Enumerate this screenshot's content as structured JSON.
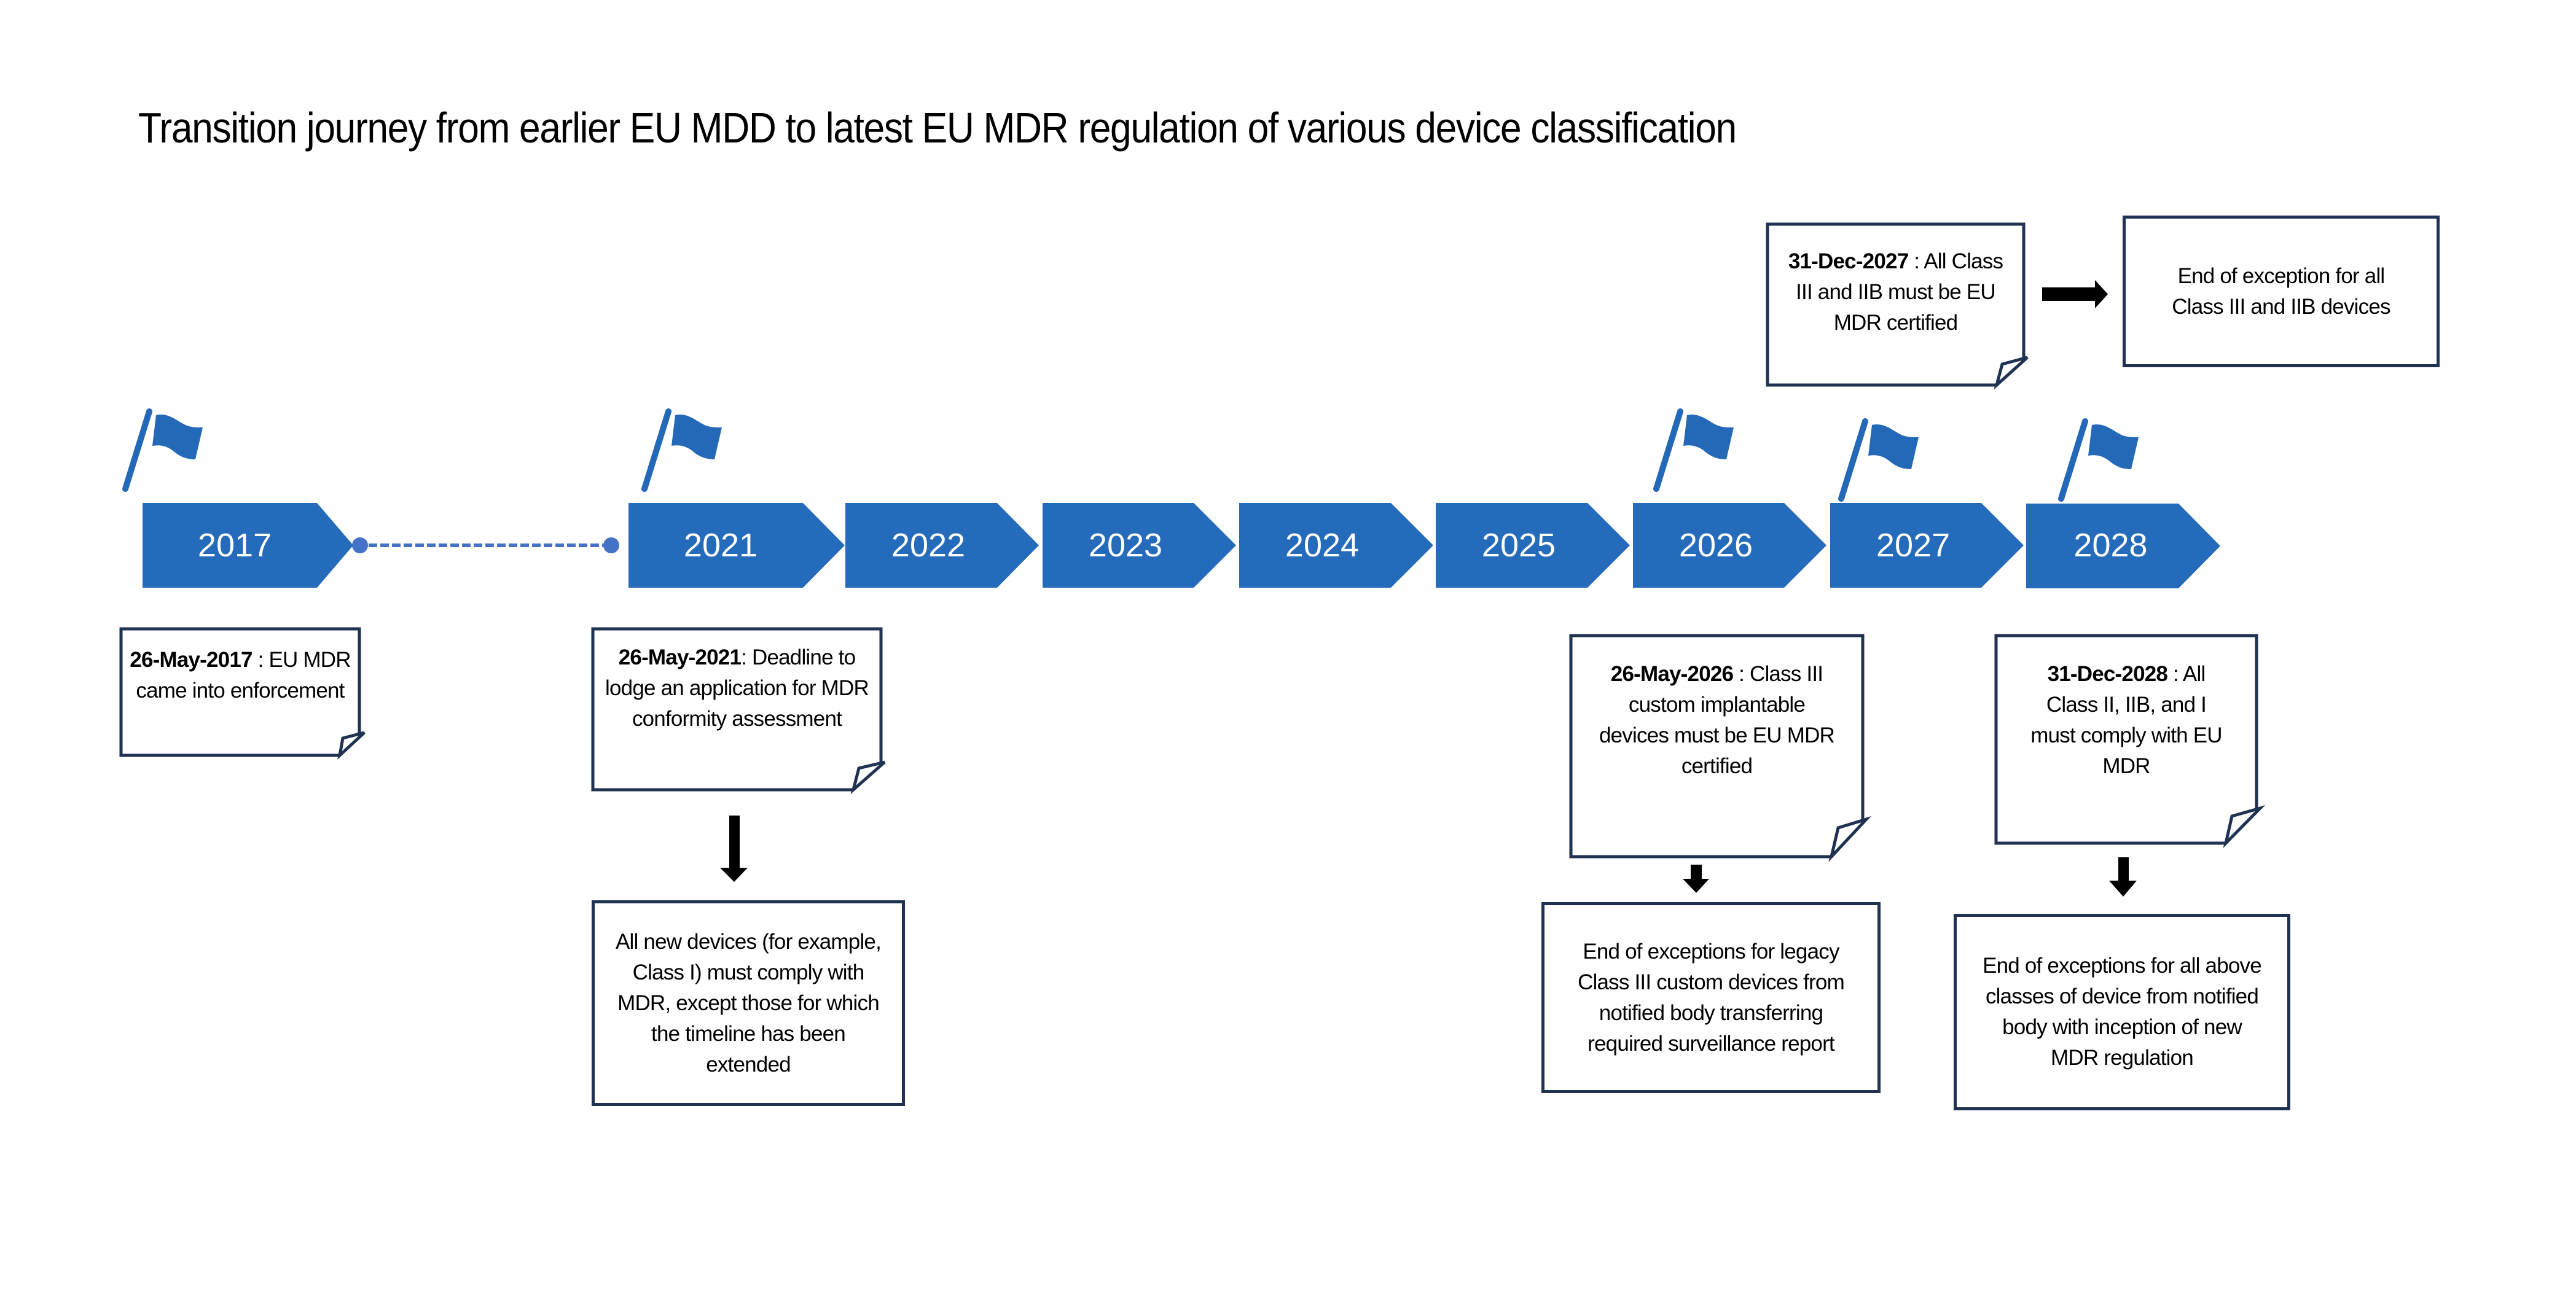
{
  "title": "Transition journey from earlier EU MDD to latest EU MDR regulation of various device classification",
  "colors": {
    "chevron": "#256bbb",
    "flag": "#2468b8",
    "connector": "#4472c4",
    "box_border": "#1f3251",
    "arrow": "#000000"
  },
  "timeline": {
    "years": [
      "2017",
      "2021",
      "2022",
      "2023",
      "2024",
      "2025",
      "2026",
      "2027",
      "2028"
    ],
    "flagged_years": [
      "2017",
      "2021",
      "2026",
      "2027",
      "2028"
    ]
  },
  "milestones": {
    "m2017": {
      "date": "26-May-2017",
      "sep": " : ",
      "text": "EU MDR came into enforcement"
    },
    "m2021": {
      "date": "26-May-2021",
      "sep": ": ",
      "text": "Deadline to lodge an application for MDR conformity assessment"
    },
    "m2026": {
      "date": "26-May-2026",
      "sep": " : ",
      "text": "Class III custom implantable devices must be EU MDR certified"
    },
    "m2027": {
      "date": "31-Dec-2027",
      "sep": " : ",
      "text": "All Class III and IIB must be EU MDR certified"
    },
    "m2028": {
      "date": "31-Dec-2028",
      "sep": " : ",
      "text": "All Class II, IIB, and I must comply with EU MDR"
    }
  },
  "outcomes": {
    "o2021": "All new devices (for example, Class I) must comply with MDR, except  those for which the timeline has been extended",
    "o2026": "End of exceptions for legacy Class III custom devices from notified body transferring required surveillance report",
    "o2027": "End of exception for all Class III and IIB devices",
    "o2028": "End of exceptions for all above classes of device from notified body with inception of new MDR regulation"
  }
}
